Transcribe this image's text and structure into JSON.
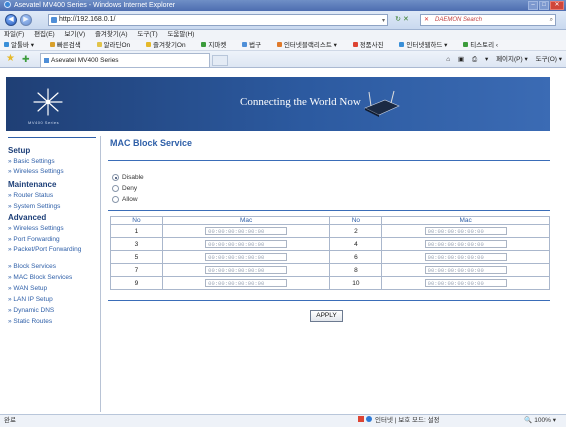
{
  "window": {
    "title": "Asevatel MV400 Series - Windows Internet Explorer",
    "address": "http://192.168.0.1/",
    "search_placeholder": "DAEMON Search",
    "menu": [
      "파일(F)",
      "편집(E)",
      "보기(V)",
      "즐겨찾기(A)",
      "도구(T)",
      "도움말(H)"
    ],
    "links": [
      "알툴바 ▾",
      "빠른검색",
      "알라딘On",
      "즐겨찾기On",
      "지마켓",
      "법구",
      "인터넷블랙리스트 ▾",
      "정품사진",
      "인터넷웹하드 ▾",
      "티스토리 ‹"
    ],
    "tab_title": "Asevatel MV400 Series",
    "tools": [
      "▾",
      "페이지(P) ▾",
      "도구(O) ▾"
    ]
  },
  "banner": {
    "logo_text": "MV400 Series",
    "tagline": "Connecting the World Now"
  },
  "nav": {
    "sections": [
      {
        "title": "Setup",
        "items": [
          "Basic Settings",
          "Wireless Settings"
        ]
      },
      {
        "title": "Maintenance",
        "items": [
          "Router Status",
          "System Settings"
        ]
      },
      {
        "title": "Advanced",
        "items": [
          "Wireless Settings",
          "Port Forwarding",
          "Packet/Port Forwarding",
          "Block Services",
          "MAC Block Services",
          "WAN Setup",
          "LAN IP Setup",
          "Dynamic DNS",
          "Static Routes"
        ]
      }
    ]
  },
  "content": {
    "title": "MAC Block Service",
    "mode_options": [
      "Disable",
      "Deny",
      "Allow"
    ],
    "selected_mode": "Disable",
    "table": {
      "headers": [
        "No",
        "Mac",
        "No",
        "Mac"
      ],
      "rows": [
        {
          "no_left": "1",
          "mac_left": "00:00:00:00:00:00",
          "no_right": "2",
          "mac_right": "00:00:00:00:00:00"
        },
        {
          "no_left": "3",
          "mac_left": "00:00:00:00:00:00",
          "no_right": "4",
          "mac_right": "00:00:00:00:00:00"
        },
        {
          "no_left": "5",
          "mac_left": "00:00:00:00:00:00",
          "no_right": "6",
          "mac_right": "00:00:00:00:00:00"
        },
        {
          "no_left": "7",
          "mac_left": "00:00:00:00:00:00",
          "no_right": "8",
          "mac_right": "00:00:00:00:00:00"
        },
        {
          "no_left": "9",
          "mac_left": "00:00:00:00:00:00",
          "no_right": "10",
          "mac_right": "00:00:00:00:00:00"
        }
      ]
    },
    "apply_label": "APPLY"
  },
  "status": {
    "left": "완료",
    "zone": "인터넷 | 보호 모드: 설정",
    "zoom": "100%"
  },
  "colors": {
    "accent": "#2e5fa8",
    "banner": "#2c5aa0"
  }
}
